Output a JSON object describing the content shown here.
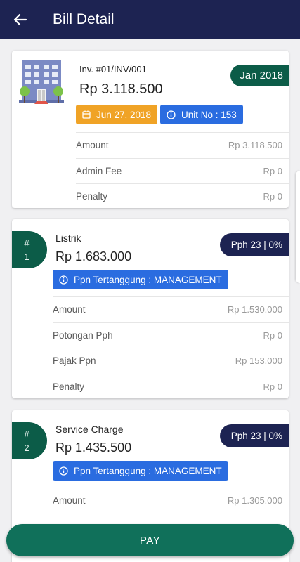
{
  "header": {
    "title": "Bill Detail",
    "back_icon": "arrow-left-icon"
  },
  "invoice": {
    "number": "Inv. #01/INV/001",
    "amount": "Rp 3.118.500",
    "period": "Jan 2018",
    "date": "Jun 27, 2018",
    "unit": "Unit No : 153",
    "rows": [
      {
        "label": "Amount",
        "value": "Rp 3.118.500"
      },
      {
        "label": "Admin Fee",
        "value": "Rp 0"
      },
      {
        "label": "Penalty",
        "value": "Rp 0"
      }
    ]
  },
  "items": [
    {
      "hash": "#",
      "index": "1",
      "name": "Listrik",
      "amount": "Rp 1.683.000",
      "pph": "Pph 23 | 0%",
      "ppn": "Ppn Tertanggung : MANAGEMENT",
      "rows": [
        {
          "label": "Amount",
          "value": "Rp 1.530.000"
        },
        {
          "label": "Potongan Pph",
          "value": "Rp 0"
        },
        {
          "label": "Pajak Ppn",
          "value": "Rp 153.000"
        },
        {
          "label": "Penalty",
          "value": "Rp 0"
        }
      ]
    },
    {
      "hash": "#",
      "index": "2",
      "name": "Service Charge",
      "amount": "Rp 1.435.500",
      "pph": "Pph 23 | 0%",
      "ppn": "Ppn Tertanggung : MANAGEMENT",
      "rows": [
        {
          "label": "Amount",
          "value": "Rp 1.305.000"
        }
      ]
    }
  ],
  "pay_label": "PAY",
  "colors": {
    "appbar": "#1d2352",
    "green": "#0c5c48",
    "orange": "#f0a326",
    "blue": "#2a6ce0",
    "pay": "#10705a"
  }
}
